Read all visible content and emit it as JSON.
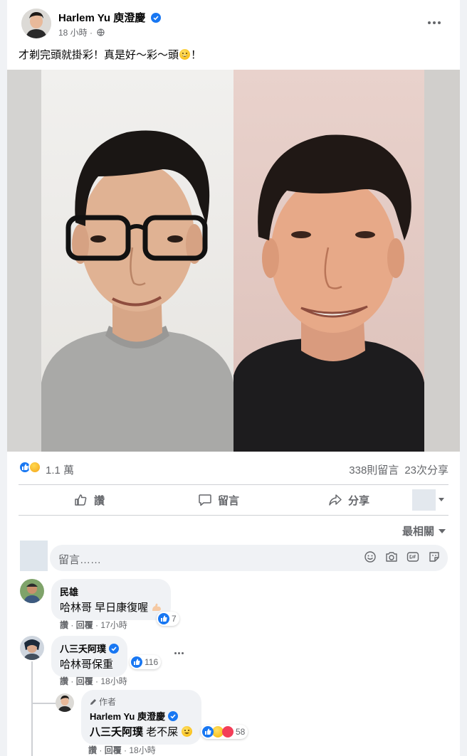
{
  "post": {
    "author": "Harlem Yu 庾澄慶",
    "time": "18 小時",
    "text_before": "才剃完頭就掛彩！真是好～彩～頭",
    "text_after": "！"
  },
  "stats": {
    "reactions": "1.1 萬",
    "comments": "338則留言",
    "shares": "23次分享"
  },
  "actions": {
    "like": "讚",
    "comment": "留言",
    "share": "分享"
  },
  "sort": {
    "label": "最相關"
  },
  "composer": {
    "placeholder": "留言……"
  },
  "comments": [
    {
      "name": "民雄",
      "text": "哈林哥 早日康復喔",
      "like": "讚",
      "reply": "回覆",
      "time": "17小時",
      "reactions": "7"
    },
    {
      "name": "八三夭阿璞",
      "text": "哈林哥保重",
      "like": "讚",
      "reply": "回覆",
      "time": "18小時",
      "reactions": "116"
    }
  ],
  "reply": {
    "tag": "作者",
    "name": "Harlem Yu 庾澄慶",
    "mention": "八三夭阿璞",
    "text": " 老不屎",
    "like": "讚",
    "reply": "回覆",
    "time": "18小時",
    "reactions": "58"
  },
  "colors": {
    "accent": "#1877f2",
    "secondary_text": "#65676b",
    "bubble": "#f0f2f5"
  }
}
